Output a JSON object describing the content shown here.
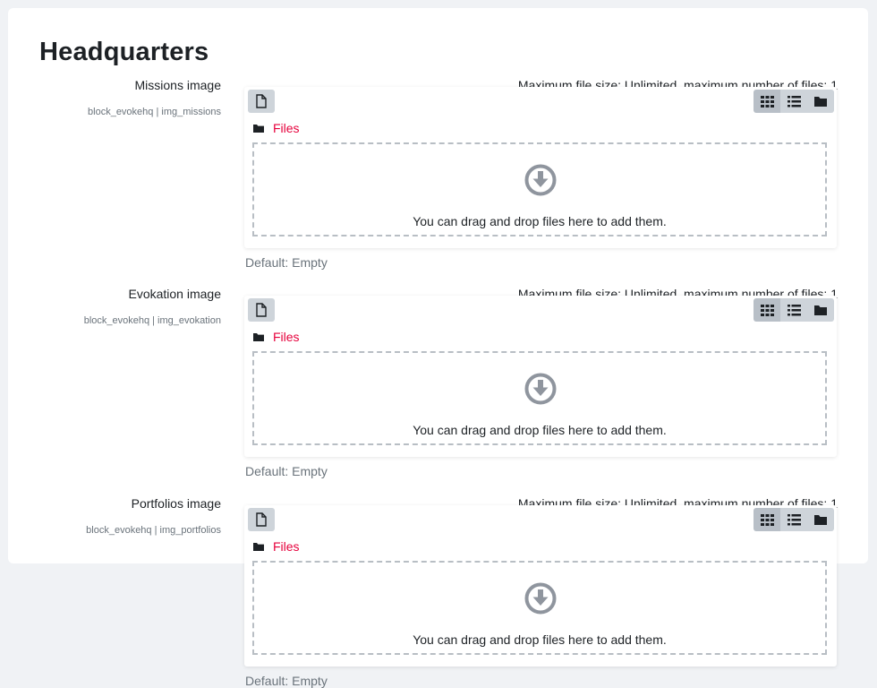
{
  "page": {
    "title": "Headquarters"
  },
  "labels": {
    "max_size": "Maximum file size: Unlimited, maximum number of files: 1",
    "path_files": "Files",
    "drop_text": "You can drag and drop files here to add them.",
    "default_value": "Default: Empty"
  },
  "settings": [
    {
      "label": "Missions image",
      "key": "block_evokehq | img_missions"
    },
    {
      "label": "Evokation image",
      "key": "block_evokehq | img_evokation"
    },
    {
      "label": "Portfolios image",
      "key": "block_evokehq | img_portfolios"
    }
  ],
  "icons": {
    "add": "file-add-icon",
    "grid": "grid-view-icon",
    "list": "list-view-icon",
    "tree": "folder-view-icon",
    "path": "folder-icon",
    "drop": "download-arrow-icon"
  },
  "colors": {
    "link": "#e6003c",
    "button": "#ced4da",
    "button_active": "#b8bfc7"
  }
}
